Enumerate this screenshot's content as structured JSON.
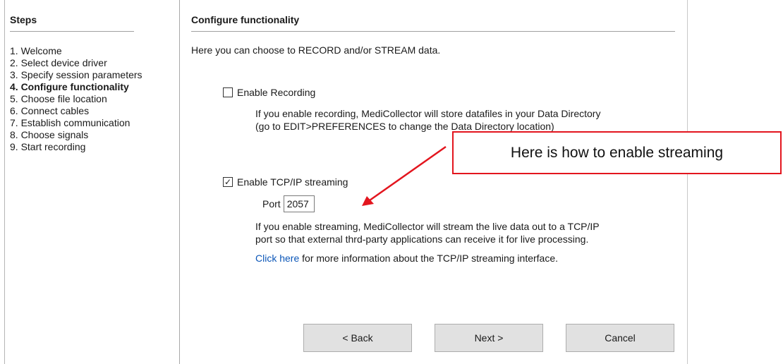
{
  "steps": {
    "title": "Steps",
    "items": [
      {
        "label": "1. Welcome",
        "active": false
      },
      {
        "label": "2. Select device driver",
        "active": false
      },
      {
        "label": "3. Specify session parameters",
        "active": false
      },
      {
        "label": "4. Configure functionality",
        "active": true
      },
      {
        "label": "5. Choose file location",
        "active": false
      },
      {
        "label": "6. Connect cables",
        "active": false
      },
      {
        "label": "7. Establish communication",
        "active": false
      },
      {
        "label": "8. Choose signals",
        "active": false
      },
      {
        "label": "9. Start recording",
        "active": false
      }
    ]
  },
  "content": {
    "title": "Configure functionality",
    "intro": "Here you can choose to RECORD and/or STREAM data.",
    "recording": {
      "label": "Enable Recording",
      "checked": false,
      "desc_line1": "If you enable recording, MediCollector will store datafiles in your Data Directory",
      "desc_line2": "(go to EDIT>PREFERENCES to change the Data Directory location)"
    },
    "streaming": {
      "label": "Enable TCP/IP streaming",
      "checked": true,
      "check_glyph": "✓",
      "port_label": "Port",
      "port_value": "2057",
      "desc_line1": "If you enable streaming, MediCollector will stream the live data out to a TCP/IP",
      "desc_line2": "port so that external thrd-party applications can receive it for live processing.",
      "link_text": "Click here",
      "link_suffix": " for more information about the TCP/IP streaming interface."
    }
  },
  "buttons": {
    "back": "< Back",
    "next": "Next >",
    "cancel": "Cancel"
  },
  "annotation": {
    "text": "Here is how to enable streaming",
    "color": "#e3151e"
  }
}
